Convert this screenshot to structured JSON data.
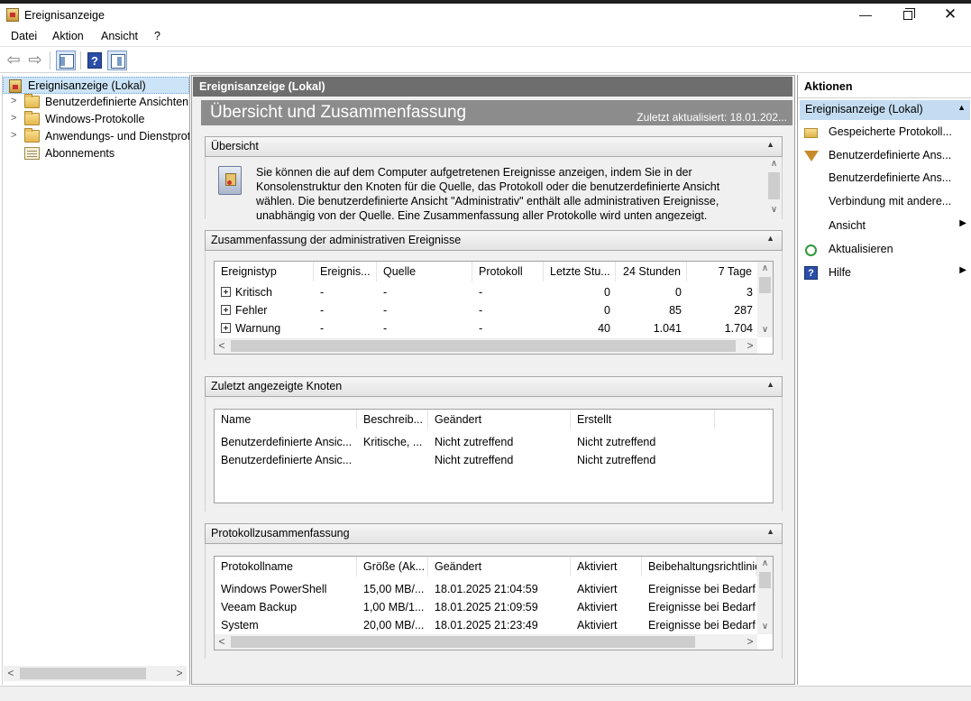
{
  "window": {
    "title": "Ereignisanzeige",
    "minimize": "—",
    "close": "✕"
  },
  "menu": [
    "Datei",
    "Aktion",
    "Ansicht",
    "?"
  ],
  "tree": {
    "root": "Ereignisanzeige (Lokal)",
    "items": [
      {
        "label": "Benutzerdefinierte Ansichten",
        "icon": "folder-icon"
      },
      {
        "label": "Windows-Protokolle",
        "icon": "folder-icon"
      },
      {
        "label": "Anwendungs- und Dienstprotokolle",
        "icon": "folder-icon"
      },
      {
        "label": "Abonnements",
        "icon": "subscription-icon"
      }
    ]
  },
  "center": {
    "header": "Ereignisanzeige (Lokal)",
    "banner_title": "Übersicht und Zusammenfassung",
    "last_updated": "Zuletzt aktualisiert: 18.01.202...",
    "overview": {
      "title": "Übersicht",
      "text": "Sie können die auf dem Computer aufgetretenen Ereignisse anzeigen, indem Sie in der Konsolenstruktur den Knoten für die Quelle, das Protokoll oder die benutzerdefinierte Ansicht wählen. Die benutzerdefinierte Ansicht \"Administrativ\" enthält alle administrativen Ereignisse, unabhängig von der Quelle. Eine Zusammenfassung aller Protokolle wird unten angezeigt."
    },
    "admin_summary": {
      "title": "Zusammenfassung der administrativen Ereignisse",
      "columns": [
        "Ereignistyp",
        "Ereignis...",
        "Quelle",
        "Protokoll",
        "Letzte Stu...",
        "24 Stunden",
        "7 Tage"
      ],
      "rows": [
        [
          "Kritisch",
          "-",
          "-",
          "-",
          "0",
          "0",
          "3"
        ],
        [
          "Fehler",
          "-",
          "-",
          "-",
          "0",
          "85",
          "287"
        ],
        [
          "Warnung",
          "-",
          "-",
          "-",
          "40",
          "1.041",
          "1.704"
        ]
      ]
    },
    "recent_nodes": {
      "title": "Zuletzt angezeigte Knoten",
      "columns": [
        "Name",
        "Beschreib...",
        "Geändert",
        "Erstellt"
      ],
      "rows": [
        [
          "Benutzerdefinierte Ansic...",
          "Kritische, ...",
          "Nicht zutreffend",
          "Nicht zutreffend"
        ],
        [
          "Benutzerdefinierte Ansic...",
          "",
          "Nicht zutreffend",
          "Nicht zutreffend"
        ]
      ]
    },
    "log_summary": {
      "title": "Protokollzusammenfassung",
      "columns": [
        "Protokollname",
        "Größe (Ak...",
        "Geändert",
        "Aktiviert",
        "Beibehaltungsrichtlinie"
      ],
      "rows": [
        [
          "Windows PowerShell",
          "15,00 MB/...",
          "18.01.2025 21:04:59",
          "Aktiviert",
          "Ereignisse bei Bedarf"
        ],
        [
          "Veeam Backup",
          "1,00 MB/1...",
          "18.01.2025 21:09:59",
          "Aktiviert",
          "Ereignisse bei Bedarf"
        ],
        [
          "System",
          "20,00 MB/...",
          "18.01.2025 21:23:49",
          "Aktiviert",
          "Ereignisse bei Bedarf"
        ]
      ]
    }
  },
  "actions": {
    "title": "Aktionen",
    "section": "Ereignisanzeige (Lokal)",
    "items": [
      {
        "label": "Gespeicherte Protokoll...",
        "icon": "folder-open-icon",
        "submenu": false
      },
      {
        "label": "Benutzerdefinierte Ans...",
        "icon": "filter-icon",
        "submenu": false
      },
      {
        "label": "Benutzerdefinierte Ans...",
        "icon": "",
        "submenu": false
      },
      {
        "label": "Verbindung mit andere...",
        "icon": "",
        "submenu": false
      },
      {
        "label": "Ansicht",
        "icon": "",
        "submenu": true
      },
      {
        "label": "Aktualisieren",
        "icon": "refresh-icon",
        "submenu": false
      },
      {
        "label": "Hilfe",
        "icon": "help-icon",
        "submenu": true
      }
    ]
  },
  "colors": {
    "selection": "#cce4f7",
    "header_dark": "#6e6e6e",
    "banner": "#8c8c8c",
    "action_section": "#c4dcf1"
  }
}
